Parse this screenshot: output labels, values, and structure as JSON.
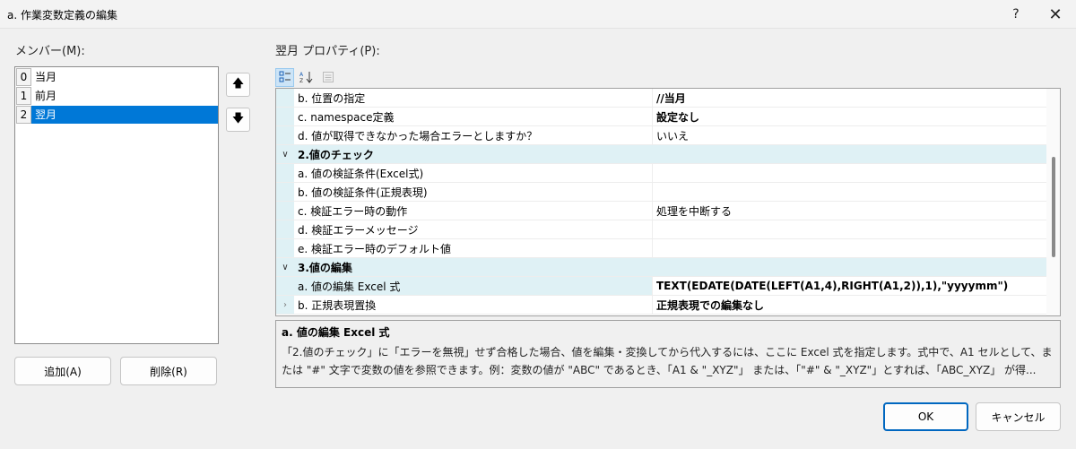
{
  "window": {
    "title": "a. 作業変数定義の編集",
    "help": "?",
    "close": "✕"
  },
  "members": {
    "label": "メンバー(M):",
    "items": [
      {
        "index": "0",
        "name": "当月"
      },
      {
        "index": "1",
        "name": "前月"
      },
      {
        "index": "2",
        "name": "翌月"
      }
    ],
    "selected_index": 2
  },
  "buttons": {
    "move_up": "🡅",
    "move_down": "🡇",
    "add": "追加(A)",
    "delete": "削除(R)",
    "ok": "OK",
    "cancel": "キャンセル"
  },
  "properties": {
    "label": "翌月 プロパティ(P):",
    "toolbar": {
      "categorized": "categorized-icon",
      "alphabetical": "sort-az-icon",
      "pages": "property-pages-icon"
    },
    "rows": [
      {
        "kind": "prop",
        "name": "b. 位置の指定",
        "value": "//当月",
        "bold": true
      },
      {
        "kind": "prop",
        "name": "c. namespace定義",
        "value": "設定なし",
        "bold": true
      },
      {
        "kind": "prop",
        "name": "d. 値が取得できなかった場合エラーとしますか？",
        "value": "いいえ",
        "bold": false
      },
      {
        "kind": "cat",
        "name": "2.値のチェック",
        "expander": "∨"
      },
      {
        "kind": "prop",
        "name": "a. 値の検証条件(Excel式)",
        "value": "",
        "bold": false
      },
      {
        "kind": "prop",
        "name": "b. 値の検証条件(正規表現)",
        "value": "",
        "bold": false
      },
      {
        "kind": "prop",
        "name": "c. 検証エラー時の動作",
        "value": "処理を中断する",
        "bold": false
      },
      {
        "kind": "prop",
        "name": "d. 検証エラーメッセージ",
        "value": "",
        "bold": false
      },
      {
        "kind": "prop",
        "name": "e. 検証エラー時のデフォルト値",
        "value": "",
        "bold": false
      },
      {
        "kind": "cat",
        "name": "3.値の編集",
        "expander": "∨"
      },
      {
        "kind": "prop",
        "name": "a. 値の編集 Excel 式",
        "value": "TEXT(EDATE(DATE(LEFT(A1,4),RIGHT(A1,2)),1),\"yyyymm\")",
        "bold": true,
        "selected": true
      },
      {
        "kind": "prop",
        "name": "b. 正規表現置換",
        "value": "正規表現での編集なし",
        "bold": true,
        "expander": "›"
      }
    ]
  },
  "description": {
    "title": "a. 値の編集 Excel 式",
    "body": "「2.値のチェック」に「エラーを無視」せず合格した場合、値を編集・変換してから代入するには、ここに Excel 式を指定します。式中で、A1 セルとして、または \"#\" 文字で変数の値を参照できます。例：変数の値が \"ABC\" であるとき、「A1 & \"_XYZ\"」 または、「\"#\" & \"_XYZ\"」とすれば、「ABC_XYZ」 が得..."
  }
}
